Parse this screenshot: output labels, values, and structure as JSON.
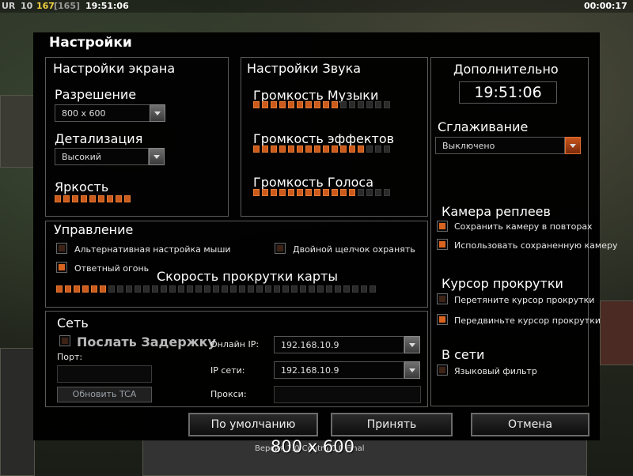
{
  "hud": {
    "faction": "UR",
    "level": "10",
    "money": "167",
    "money_bracket": "[165]",
    "game_clock": "19:51:06",
    "timer": "00:00:17"
  },
  "dialog": {
    "title": "Настройки",
    "screen": {
      "title": "Настройки экрана",
      "resolution_label": "Разрешение",
      "resolution_value": "800 x 600",
      "detail_label": "Детализация",
      "detail_value": "Высокий",
      "brightness_label": "Яркость",
      "brightness_level": 9,
      "brightness_max": 9
    },
    "sound": {
      "title": "Настройки Звука",
      "music_label": "Громкость Музыки",
      "music_level": 10,
      "effects_label": "Громкость эффектов",
      "effects_level": 13,
      "voice_label": "Громкость Голоса",
      "voice_level": 12,
      "max": 16
    },
    "extra": {
      "title": "Дополнительно",
      "clock": "19:51:06",
      "antialias_label": "Сглаживание",
      "antialias_value": "Выключено",
      "replay_camera_title": "Камера реплеев",
      "save_camera_label": "Сохранить камеру в повторах",
      "use_saved_camera_label": "Использовать сохраненную камеру",
      "cursor_title": "Курсор прокрутки",
      "drag_cursor_label": "Перетяните курсор прокрутки",
      "move_cursor_label": "Передвиньте курсор прокрутки",
      "online_title": "В сети",
      "language_filter_label": "Языковый фильтр"
    },
    "control": {
      "title": "Управление",
      "alt_mouse_label": "Альтернативная настройка мыши",
      "double_click_label": "Двойной щелчок охранять",
      "return_fire_label": "Ответный огонь",
      "scroll_speed_label": "Скорость прокрутки карты",
      "scroll_level": 6,
      "scroll_max": 37
    },
    "network": {
      "title": "Сеть",
      "send_delay_label": "Послать Задержку",
      "port_label": "Порт:",
      "update_tca_label": "Обновить TCA",
      "online_ip_label": "Онлайн IP:",
      "online_ip_value": "192.168.10.9",
      "lan_ip_label": "IP сети:",
      "lan_ip_value": "192.168.10.9",
      "proxy_label": "Прокси:"
    },
    "buttons": {
      "defaults": "По умолчанию",
      "accept": "Принять",
      "cancel": "Отмена"
    }
  },
  "overlay": {
    "version_text": "Версия 1.0 Contra 0.0 Final",
    "resolution_caption": "800 x 600"
  },
  "checkboxes": {
    "save_camera": true,
    "use_saved_camera": true,
    "drag_cursor": false,
    "move_cursor": true,
    "language_filter": false,
    "alt_mouse": false,
    "double_click": false,
    "return_fire": true,
    "send_delay": false
  }
}
